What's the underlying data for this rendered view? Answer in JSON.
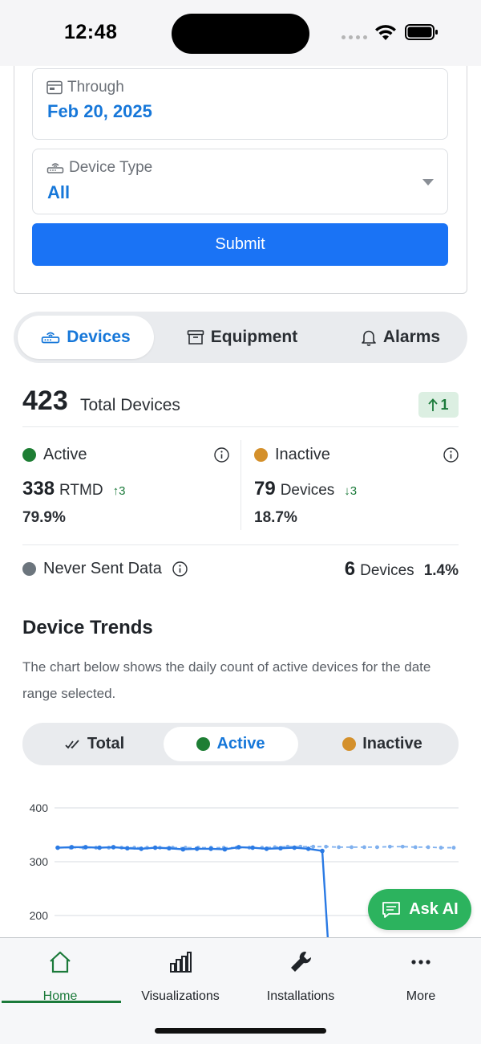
{
  "status_bar": {
    "time": "12:48"
  },
  "filters": {
    "through": {
      "label": "Through",
      "value": "Feb 20, 2025",
      "icon": "calendar-icon"
    },
    "device_type": {
      "label": "Device Type",
      "value": "All",
      "icon": "router-icon"
    },
    "submit_label": "Submit"
  },
  "tabs": [
    {
      "label": "Devices",
      "icon": "router-icon",
      "active": true
    },
    {
      "label": "Equipment",
      "icon": "archive-box-icon",
      "active": false
    },
    {
      "label": "Alarms",
      "icon": "bell-icon",
      "active": false
    }
  ],
  "summary": {
    "total_count": "423",
    "total_label": "Total Devices",
    "total_change": "1",
    "active": {
      "label": "Active",
      "count": "338",
      "unit": "RTMD",
      "change": "↑3",
      "percent": "79.9%",
      "color": "#1e7e34"
    },
    "inactive": {
      "label": "Inactive",
      "count": "79",
      "unit": "Devices",
      "change": "↓3",
      "percent": "18.7%",
      "color": "#d4902b"
    },
    "never_sent": {
      "label": "Never Sent Data",
      "count": "6",
      "unit": "Devices",
      "percent": "1.4%",
      "color": "#6c757d"
    }
  },
  "trends": {
    "title": "Device Trends",
    "description": "The chart below shows the daily count of active devices for the date range selected.",
    "chart_tabs": [
      {
        "label": "Total",
        "icon": "double-check-icon",
        "active": false
      },
      {
        "label": "Active",
        "icon": "green-dot",
        "active": true
      },
      {
        "label": "Inactive",
        "icon": "orange-dot",
        "active": false
      }
    ]
  },
  "chart_data": {
    "type": "line",
    "ylim": [
      170,
      410
    ],
    "yticks": [
      "400",
      "300",
      "200"
    ],
    "ytick_values": [
      400,
      300,
      200
    ],
    "grid": true,
    "series": [
      {
        "style": "solid",
        "values": [
          326,
          327,
          327,
          326,
          327,
          325,
          324,
          326,
          325,
          323,
          324,
          324,
          323,
          327,
          326,
          324,
          325,
          326,
          324,
          320,
          160
        ]
      },
      {
        "style": "dashed",
        "values": [
          326,
          326,
          326,
          326,
          326,
          326,
          326,
          326,
          326,
          326,
          326,
          326,
          326,
          326,
          326,
          326,
          326,
          327,
          328,
          328,
          328,
          328,
          327,
          327,
          327,
          327,
          328,
          328,
          327,
          327,
          326,
          326
        ]
      }
    ]
  },
  "ask_ai": {
    "label": "Ask AI",
    "icon": "chat-icon"
  },
  "nav": [
    {
      "label": "Home",
      "icon": "home-icon",
      "active": true
    },
    {
      "label": "Visualizations",
      "icon": "bar-chart-icon",
      "active": false
    },
    {
      "label": "Installations",
      "icon": "wrench-icon",
      "active": false
    },
    {
      "label": "More",
      "icon": "more-icon",
      "active": false
    }
  ],
  "colors": {
    "accent": "#1677d9",
    "submit": "#1a73f5",
    "positive": "#1b7a3a",
    "ask_ai": "#2cb35e"
  }
}
